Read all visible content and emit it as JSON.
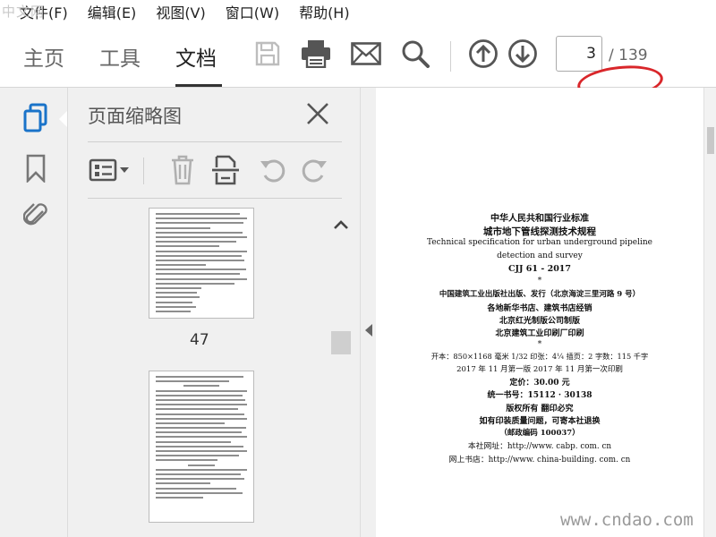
{
  "menu": {
    "file": "文件(F)",
    "edit": "编辑(E)",
    "view": "视图(V)",
    "window": "窗口(W)",
    "help": "帮助(H)"
  },
  "watermark_top": "中文网",
  "tabs": {
    "home": "主页",
    "tools": "工具",
    "document": "文档"
  },
  "pager": {
    "current": "3",
    "total": "/ 139"
  },
  "panel": {
    "title": "页面缩略图"
  },
  "thumbnail": {
    "page_number": "47"
  },
  "document": {
    "l1": "中华人民共和国行业标准",
    "l2": "城市地下管线探测技术规程",
    "l3": "Technical specification for urban underground pipeline",
    "l4": "detection and survey",
    "l5": "CJJ 61 - 2017",
    "l6": "*",
    "l7": "中国建筑工业出版社出版、发行（北京海淀三里河路 9 号）",
    "l8": "各地新华书店、建筑书店经销",
    "l9": "北京红光制版公司制版",
    "l10": "北京建筑工业印刷厂印刷",
    "l11": "*",
    "l12": "开本：850×1168 毫米 1/32 印张：4¼ 插页：2 字数：115 千字",
    "l13": "2017 年 11 月第一版 2017 年 11 月第一次印刷",
    "l14": "定价：30.00 元",
    "l15": "统一书号：15112 · 30138",
    "l16": "版权所有 翻印必究",
    "l17": "如有印装质量问题，可寄本社退换",
    "l18": "（邮政编码 100037）",
    "l19": "本社网址：http://www. cabp. com. cn",
    "l20": "网上书店：http://www. china-building. com. cn"
  },
  "watermark_bottom": "www.cndao.com",
  "colors": {
    "annotation": "#d9262a",
    "active_icon": "#1a73c9"
  }
}
